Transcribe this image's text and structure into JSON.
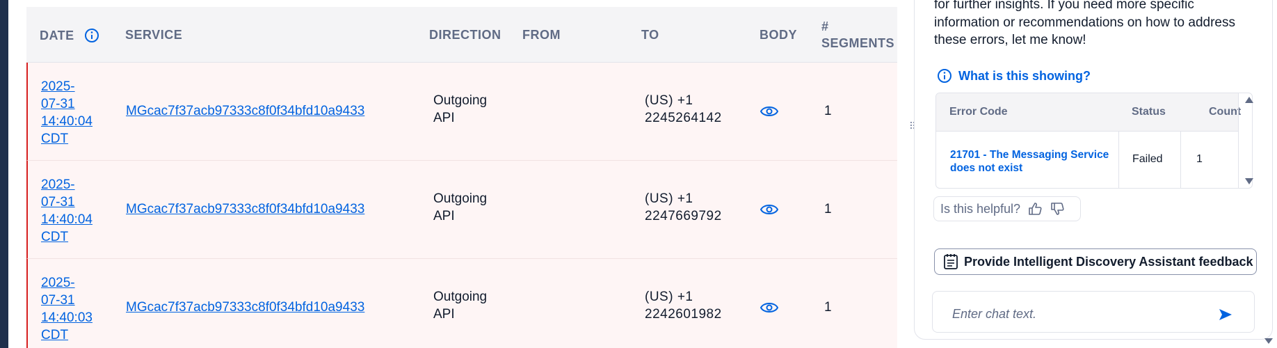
{
  "table": {
    "headers": {
      "date": "DATE",
      "service": "SERVICE",
      "direction": "DIRECTION",
      "from": "FROM",
      "to": "TO",
      "body": "BODY",
      "segments_line1": "#",
      "segments_line2": "SEGMENTS"
    },
    "rows": [
      {
        "date": [
          "2025-",
          "07-31",
          "14:40:04",
          "CDT"
        ],
        "service": "MGcac7f37acb97333c8f0f34bfd10a9433",
        "direction": [
          "Outgoing",
          "API"
        ],
        "from": "",
        "to": [
          "(US) +1",
          "2245264142"
        ],
        "segments": "1"
      },
      {
        "date": [
          "2025-",
          "07-31",
          "14:40:04",
          "CDT"
        ],
        "service": "MGcac7f37acb97333c8f0f34bfd10a9433",
        "direction": [
          "Outgoing",
          "API"
        ],
        "from": "",
        "to": [
          "(US) +1",
          "2247669792"
        ],
        "segments": "1"
      },
      {
        "date": [
          "2025-",
          "07-31",
          "14:40:03",
          "CDT"
        ],
        "service": "MGcac7f37acb97333c8f0f34bfd10a9433",
        "direction": [
          "Outgoing",
          "API"
        ],
        "from": "",
        "to": [
          "(US) +1",
          "2242601982"
        ],
        "segments": "1"
      }
    ],
    "error_row_accent": "#d61f1f"
  },
  "assistant": {
    "message_lines": [
      "for further insights. If you need more specific",
      "information or recommendations on how to address",
      "these errors, let me know!"
    ],
    "what_showing": "What is this showing?",
    "error_table": {
      "headers": {
        "code": "Error Code",
        "status": "Status",
        "count": "Count"
      },
      "rows": [
        {
          "code": "21701 - The Messaging Service does not exist",
          "status": "Failed",
          "count": "1"
        }
      ]
    },
    "helpful_label": "Is this helpful?",
    "feedback_button": "Provide Intelligent Discovery Assistant feedback",
    "chat_placeholder": "Enter chat text."
  },
  "icons": {
    "info": "info-icon",
    "eye": "eye-icon",
    "thumbs_up": "thumbs-up-icon",
    "thumbs_down": "thumbs-down-icon",
    "notes": "notes-icon",
    "send": "send-icon",
    "drag_handle": "drag-handle-icon"
  },
  "colors": {
    "link": "#0263e0",
    "row_error_bg": "#fef5f5",
    "header_bg": "#f4f4f6"
  }
}
